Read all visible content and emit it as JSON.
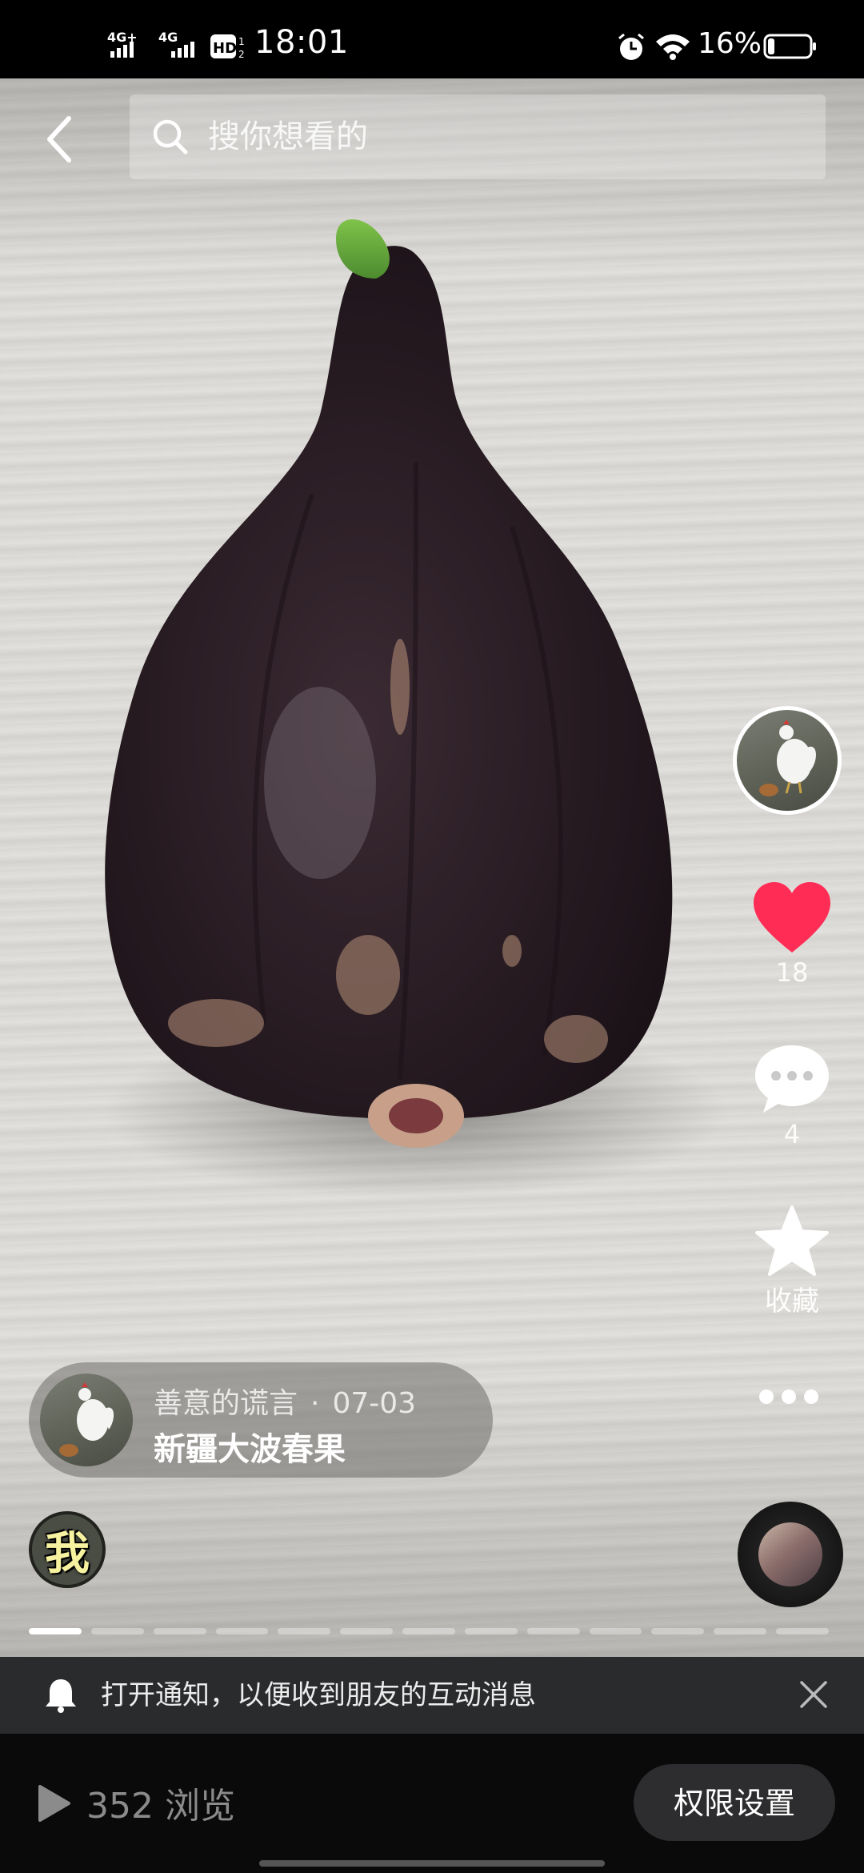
{
  "status_bar": {
    "network_1": "4G+",
    "network_2": "4G",
    "hd": "HD",
    "time": "18:01",
    "battery_percent": "16%",
    "battery_level": 0.16
  },
  "header": {
    "back_icon": "back-arrow-icon",
    "search_icon": "search-icon",
    "search_placeholder": "搜你想看的"
  },
  "right_rail": {
    "like_count": "18",
    "comment_count": "4",
    "favorite_label": "收藏",
    "colors": {
      "like": "#ff2d55"
    }
  },
  "post": {
    "author": "善意的谎言",
    "separator": "·",
    "date": "07-03",
    "title": "新疆大波春果"
  },
  "me_avatar_text": "我",
  "progress": {
    "segments": 13,
    "active_index": 0
  },
  "notification": {
    "text": "打开通知，以便收到朋友的互动消息"
  },
  "bottom_bar": {
    "views": "352 浏览",
    "permission_button": "权限设置"
  }
}
